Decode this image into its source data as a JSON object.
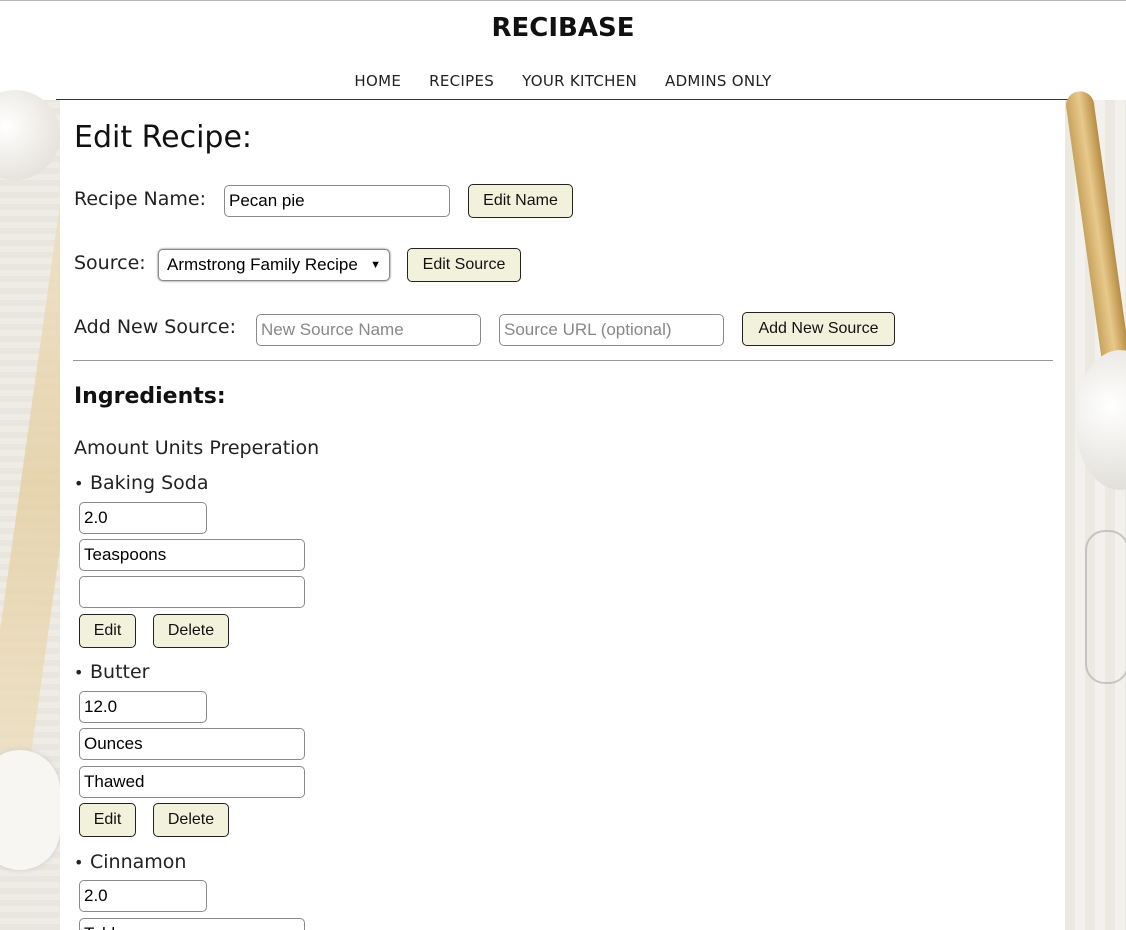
{
  "site": {
    "brand": "RECIBASE"
  },
  "nav": [
    {
      "label": "HOME"
    },
    {
      "label": "RECIPES"
    },
    {
      "label": "YOUR KITCHEN"
    },
    {
      "label": "ADMINS ONLY"
    }
  ],
  "page": {
    "title": "Edit Recipe:"
  },
  "recipe_name": {
    "label": "Recipe Name:",
    "value": "Pecan pie",
    "button": "Edit Name"
  },
  "source": {
    "label": "Source:",
    "selected": "Armstrong Family Recipe",
    "button": "Edit Source"
  },
  "new_source": {
    "label": "Add New Source:",
    "name_placeholder": "New Source Name",
    "url_placeholder": "Source URL (optional)",
    "button": "Add New Source"
  },
  "ingredients": {
    "title": "Ingredients:",
    "columns_header": "Amount Units Preperation",
    "bullet": "•",
    "edit_label": "Edit",
    "delete_label": "Delete",
    "items": [
      {
        "name": "Baking Soda",
        "amount": "2.0",
        "units": "Teaspoons",
        "preparation": ""
      },
      {
        "name": "Butter",
        "amount": "12.0",
        "units": "Ounces",
        "preparation": "Thawed"
      },
      {
        "name": "Cinnamon",
        "amount": "2.0",
        "units": "Tablespoons",
        "preparation": ""
      }
    ]
  }
}
